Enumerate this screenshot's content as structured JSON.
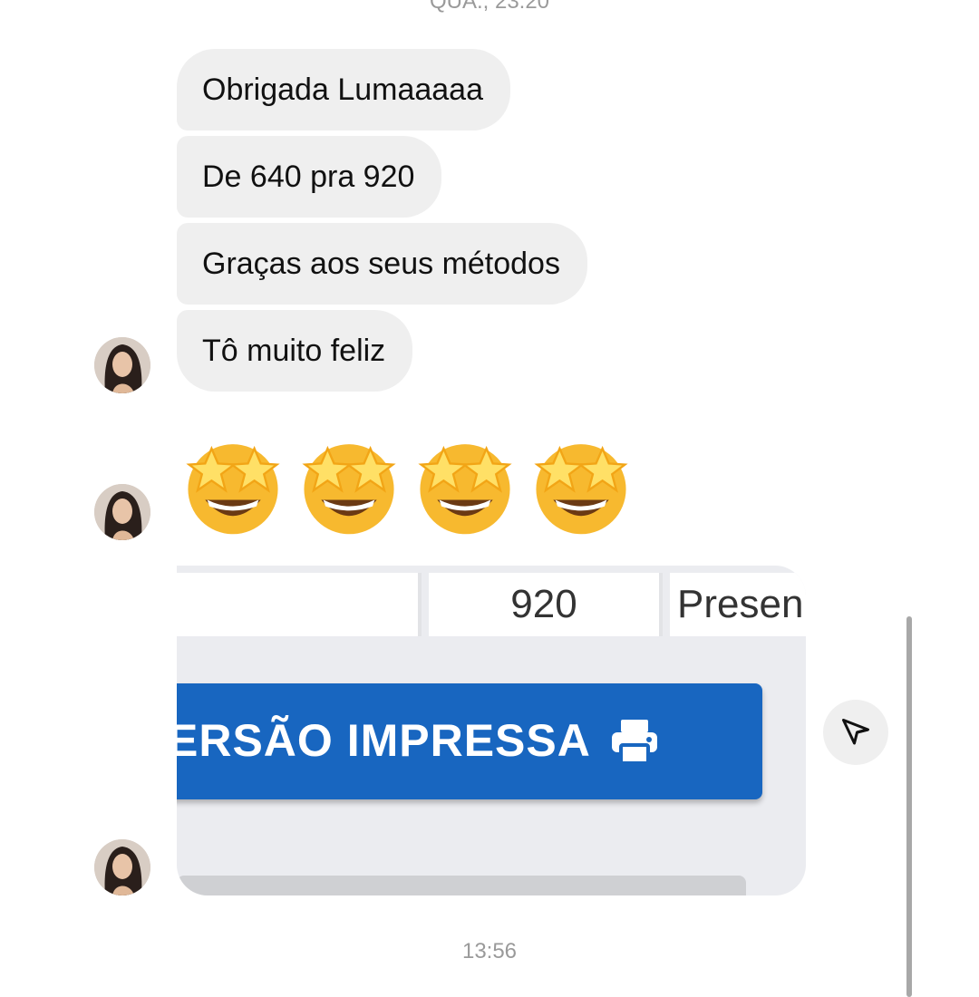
{
  "timestamps": {
    "top": "QUA., 23:20",
    "bottom": "13:56"
  },
  "messages": [
    {
      "text": "Obrigada Lumaaaaa"
    },
    {
      "text": "De 640 pra 920"
    },
    {
      "text": "Graças aos seus métodos"
    },
    {
      "text": "Tô muito feliz"
    }
  ],
  "emoji_message": {
    "emojis": [
      "star-struck",
      "star-struck",
      "star-struck",
      "star-struck"
    ]
  },
  "shared_image": {
    "table_cells": [
      "",
      "920",
      "Presen"
    ],
    "button_label": "ERSÃO IMPRESSA",
    "button_icon": "printer-icon",
    "button_color": "#1866c0"
  },
  "share_button": {
    "icon": "send-icon"
  },
  "colors": {
    "bubble": "#efefef",
    "timestamp": "#9a9a9a"
  }
}
